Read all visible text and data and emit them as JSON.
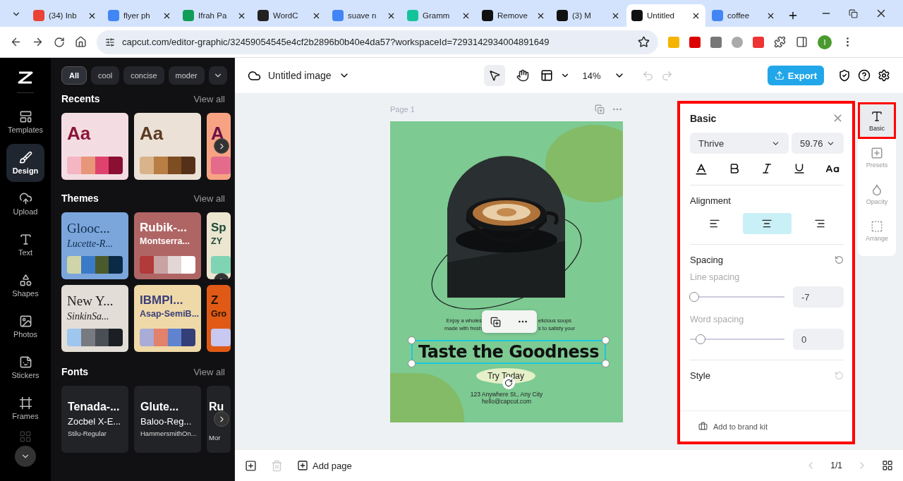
{
  "browser": {
    "tabs": [
      {
        "label": "(34) Inb",
        "selected": false,
        "color": "#ea4335"
      },
      {
        "label": "flyer ph",
        "selected": false,
        "color": "#4285f4"
      },
      {
        "label": "Ifrah Pa",
        "selected": false,
        "color": "#0f9d58"
      },
      {
        "label": "WordC",
        "selected": false,
        "color": "#222222"
      },
      {
        "label": "suave n",
        "selected": false,
        "color": "#4285f4"
      },
      {
        "label": "Gramm",
        "selected": false,
        "color": "#15c39a"
      },
      {
        "label": "Remove",
        "selected": false,
        "color": "#111111"
      },
      {
        "label": "(3) M",
        "selected": false,
        "color": "#111111"
      },
      {
        "label": "Untitled",
        "selected": true,
        "color": "#111111"
      },
      {
        "label": "coffee",
        "selected": false,
        "color": "#4285f4"
      }
    ],
    "address": "capcut.com/editor-graphic/32459054545e4cf2b2896b0b40e4da57?workspaceId=7293142934004891649",
    "profile": "I"
  },
  "rail": [
    {
      "label": "Templates",
      "selected": false
    },
    {
      "label": "Design",
      "selected": true
    },
    {
      "label": "Upload",
      "selected": false
    },
    {
      "label": "Text",
      "selected": false
    },
    {
      "label": "Shapes",
      "selected": false
    },
    {
      "label": "Photos",
      "selected": false
    },
    {
      "label": "Stickers",
      "selected": false
    },
    {
      "label": "Frames",
      "selected": false
    }
  ],
  "filters": [
    {
      "label": "All",
      "selected": true
    },
    {
      "label": "cool",
      "selected": false
    },
    {
      "label": "concise",
      "selected": false
    },
    {
      "label": "moder",
      "selected": false
    }
  ],
  "recents": {
    "title": "Recents",
    "link": "View all",
    "cards": [
      {
        "sample": "Aa"
      },
      {
        "sample": "Aa"
      },
      {
        "sample": "A"
      }
    ]
  },
  "themes": {
    "title": "Themes",
    "link": "View all",
    "cards": [
      {
        "heading": "Glooc...",
        "sub": "Lucette-R..."
      },
      {
        "heading": "Rubik-...",
        "sub": "Montserra..."
      },
      {
        "heading": "Sp",
        "sub": "ZY"
      },
      {
        "heading": "New Y...",
        "sub": "SinkinSa..."
      },
      {
        "heading": "IBMPl...",
        "sub": "Asap-SemiB..."
      },
      {
        "heading": "Z",
        "sub": "Gro"
      }
    ]
  },
  "fonts": {
    "title": "Fonts",
    "link": "View all",
    "cards": [
      {
        "lines": [
          "Tenada-...",
          "Zocbel X-E...",
          "Stilu-Regular"
        ]
      },
      {
        "lines": [
          "Glute...",
          "Baloo-Reg...",
          "HammersmithOn..."
        ]
      },
      {
        "lines": [
          "Ru",
          "Mor"
        ]
      }
    ]
  },
  "toolbar": {
    "title": "Untitled image",
    "zoom": "14%",
    "export": "Export",
    "tools": [
      {
        "kind": "select",
        "selected": true
      },
      {
        "kind": "hand",
        "selected": false
      }
    ]
  },
  "canvas": {
    "page_label": "Page 1",
    "paragraph": [
      {
        "text": "Enjoy a wholes"
      },
      {
        "text": "elicious soups"
      },
      {
        "text": "made with fresh"
      },
      {
        "text": "s to satisfy your"
      }
    ],
    "headline": "Taste the Goodness",
    "button": "Try Today",
    "address": "123 Anywhere St., Any City",
    "email": "hello@capcut.com"
  },
  "bottom": {
    "add_page": "Add page",
    "pages": "1/1"
  },
  "properties": {
    "highlighted": true,
    "title": "Basic",
    "font": "Thrive",
    "size": "59.76",
    "alignment": [
      {
        "kind": "left",
        "selected": false
      },
      {
        "kind": "center",
        "selected": true
      },
      {
        "kind": "right",
        "selected": false
      }
    ],
    "spacing": {
      "title": "Spacing",
      "controls": [
        {
          "label": "Line spacing",
          "level": 0.02,
          "value": "-7"
        },
        {
          "label": "Word spacing",
          "level": 0.09,
          "value": "0"
        }
      ]
    },
    "alignment_title": "Alignment",
    "style": "Style",
    "brand": "Add to brand kit"
  },
  "side_tabs": [
    {
      "label": "Basic",
      "selected": true,
      "highlighted": true
    },
    {
      "label": "Presets",
      "selected": false,
      "highlighted": false
    },
    {
      "label": "Opacity",
      "selected": false,
      "highlighted": false
    },
    {
      "label": "Arrange",
      "selected": false,
      "highlighted": false
    }
  ]
}
